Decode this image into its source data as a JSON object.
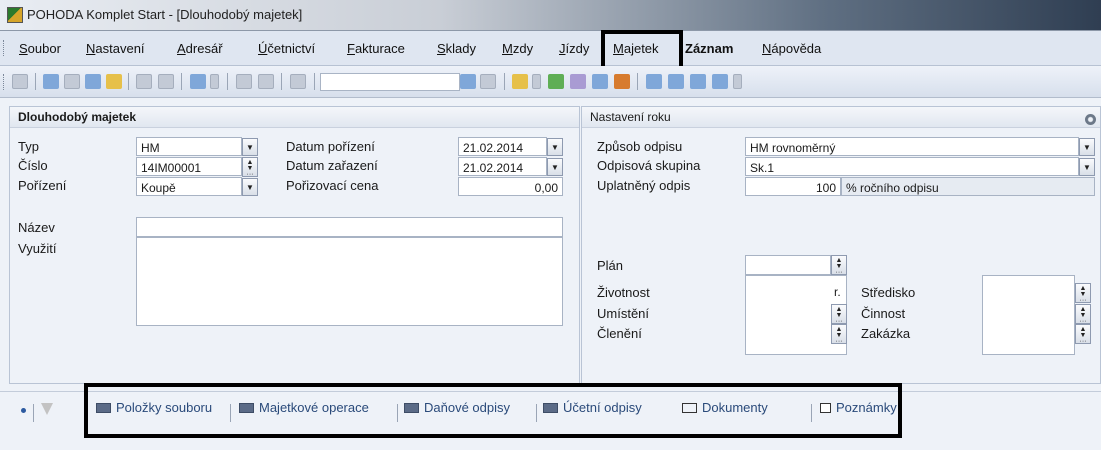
{
  "window": {
    "title": "POHODA Komplet Start - [Dlouhodobý majetek]"
  },
  "menu": [
    "Soubor",
    "Nastavení",
    "Adresář",
    "Účetnictví",
    "Fakturace",
    "Sklady",
    "Mzdy",
    "Jízdy",
    "Majetek",
    "Záznam",
    "Nápověda"
  ],
  "left_panel": {
    "title": "Dlouhodobý majetek",
    "typ_label": "Typ",
    "typ_value": "HM",
    "cislo_label": "Číslo",
    "cislo_value": "14IM00001",
    "porizeni_label": "Pořízení",
    "porizeni_value": "Koupě",
    "datum_porizeni_label": "Datum pořízení",
    "datum_porizeni_value": "21.02.2014",
    "datum_zarazeni_label": "Datum zařazení",
    "datum_zarazeni_value": "21.02.2014",
    "porizovaci_cena_label": "Pořizovací cena",
    "porizovaci_cena_value": "0,00",
    "nazev_label": "Název",
    "nazev_value": "",
    "vyuziti_label": "Využití",
    "vyuziti_value": ""
  },
  "right_panel": {
    "title": "Nastavení roku",
    "zpusob_label": "Způsob odpisu",
    "zpusob_value": "HM rovnoměrný",
    "skupina_label": "Odpisová skupina",
    "skupina_value": "Sk.1",
    "uplatneny_label": "Uplatněný odpis",
    "uplatneny_value": "100",
    "uplatneny_unit": "% ročního odpisu",
    "plan_label": "Plán",
    "zivotnost_label": "Životnost",
    "zivotnost_unit": "r.",
    "umisteni_label": "Umístění",
    "cleneni_label": "Členění",
    "stredisko_label": "Středisko",
    "cinnost_label": "Činnost",
    "zakazka_label": "Zakázka"
  },
  "tabs": [
    "Položky souboru",
    "Majetkové operace",
    "Daňové odpisy",
    "Účetní odpisy",
    "Dokumenty",
    "Poznámky"
  ],
  "icons": {
    "app": "pohoda-app-icon",
    "gear": "gear-icon"
  },
  "colors": {
    "highlight_border": "#000000",
    "tab_text": "#2a4a7a"
  }
}
